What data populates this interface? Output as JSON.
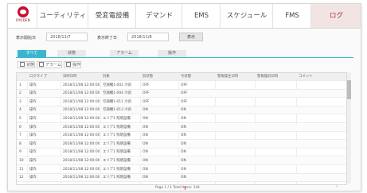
{
  "nav": {
    "logo_text": "RYODEN",
    "tabs": [
      "ユーティリティ",
      "受変電設備",
      "デマンド",
      "EMS",
      "スケジュール",
      "FMS",
      "ログ"
    ],
    "active_tab": "ログ"
  },
  "filter": {
    "start_label": "表示開始日",
    "start_value": "2018/11/7",
    "end_label": "表示終了日",
    "end_value": "2018/11/8",
    "search_label": "表示"
  },
  "subtabs": [
    "すべて",
    "状態",
    "アラーム",
    "操作"
  ],
  "checks": [
    "状態",
    "アラーム",
    "操作"
  ],
  "table": {
    "headers": [
      "",
      "ログタイプ",
      "日時日時",
      "対象",
      "前状態",
      "今状態",
      "警報発生日時",
      "警報復旧日時",
      "コメント"
    ],
    "rows": [
      [
        "1",
        "操作",
        "2018/11/08 12:00:00",
        "空調機1-002 冷房",
        "OFF",
        "OFF",
        "",
        "",
        ""
      ],
      [
        "2",
        "操作",
        "2018/11/08 12:00:00",
        "空調機1-004 冷房",
        "OFF",
        "OFF",
        "",
        "",
        ""
      ],
      [
        "3",
        "操作",
        "2018/11/08 12:00:00",
        "空調機1-011 冷房",
        "OFF",
        "OFF",
        "",
        "",
        ""
      ],
      [
        "4",
        "操作",
        "2018/11/08 12:00:00",
        "空調機1-013 冷房",
        "ON",
        "ON",
        "",
        "",
        ""
      ],
      [
        "5",
        "操作",
        "2018/11/08 12:00:00",
        "エリア1 照明設備",
        "ON",
        "ON",
        "",
        "",
        ""
      ],
      [
        "6",
        "操作",
        "2018/11/08 12:00:00",
        "エリア1 照明設備",
        "ON",
        "ON",
        "",
        "",
        ""
      ],
      [
        "7",
        "操作",
        "2018/11/08 12:00:00",
        "エリア1 照明設備",
        "ON",
        "ON",
        "",
        "",
        ""
      ],
      [
        "8",
        "操作",
        "2018/11/08 12:00:00",
        "エリア1 照明設備",
        "ON",
        "ON",
        "",
        "",
        ""
      ],
      [
        "9",
        "操作",
        "2018/11/08 12:00:00",
        "エリア1 照明設備",
        "ON",
        "ON",
        "",
        "",
        ""
      ],
      [
        "10",
        "操作",
        "2018/11/08 12:00:00",
        "エリア1 照明設備",
        "ON",
        "ON",
        "",
        "",
        ""
      ],
      [
        "11",
        "操作",
        "2018/11/08 12:00:00",
        "エリア1 照明設備",
        "ON",
        "ON",
        "",
        "",
        ""
      ],
      [
        "12",
        "操作",
        "2018/11/08 12:00:00",
        "エリア1 照明設備",
        "ON",
        "ON",
        "",
        "",
        ""
      ]
    ]
  },
  "footer": {
    "pager": "Page 1 / 1    Total Items: 144"
  },
  "colors": {
    "accent": "#3ab7cf",
    "active_nav_bg": "#f3e4e4",
    "logo_red": "#c8102e"
  }
}
